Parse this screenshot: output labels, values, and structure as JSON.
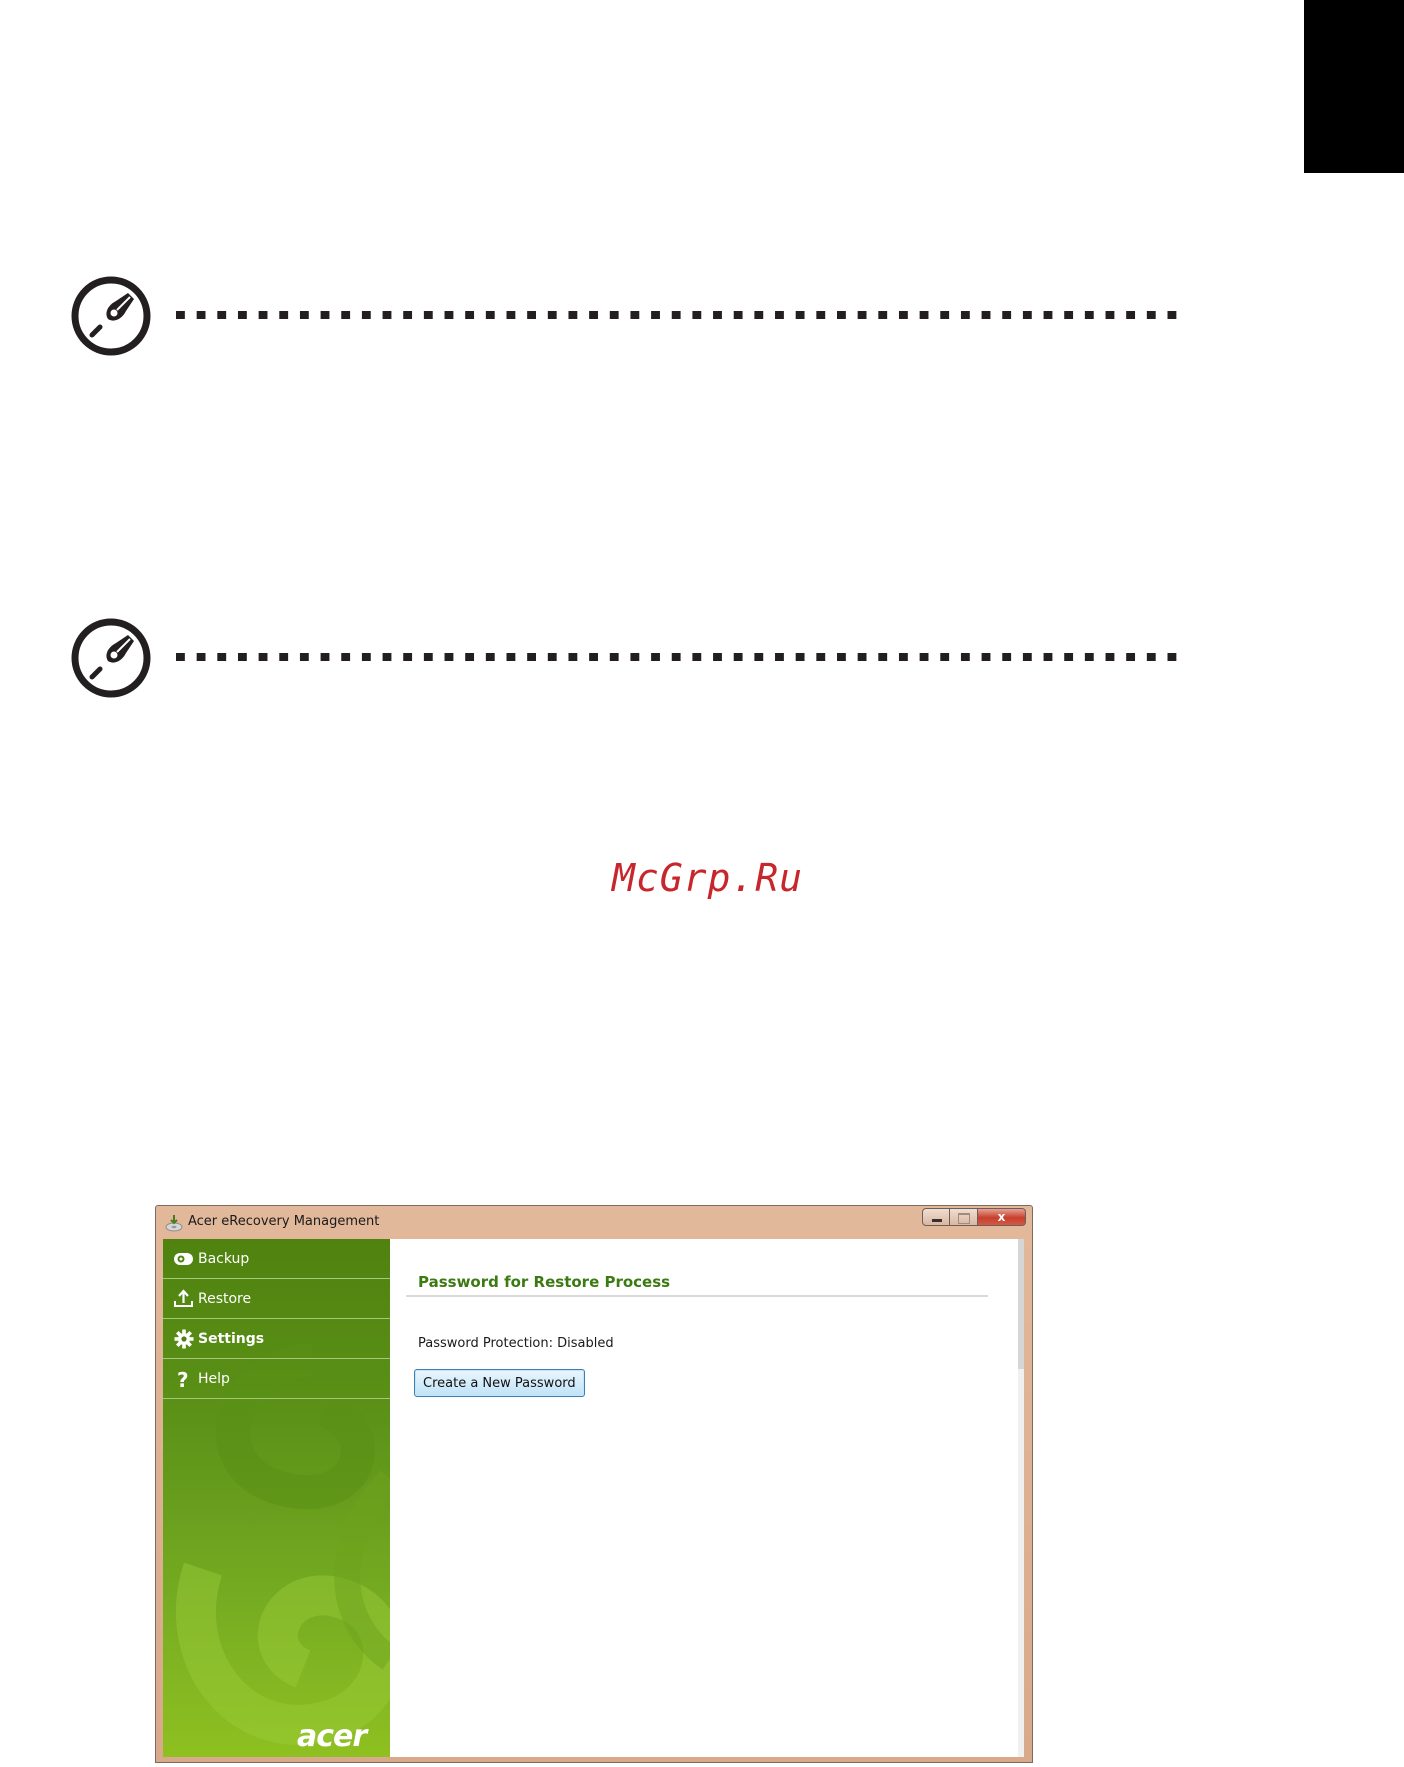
{
  "window": {
    "title": "Acer eRecovery Management",
    "close_glyph": "x"
  },
  "sidebar": {
    "items": [
      {
        "label": "Backup",
        "icon": "backup-icon"
      },
      {
        "label": "Restore",
        "icon": "restore-icon"
      },
      {
        "label": "Settings",
        "icon": "gear-icon",
        "active": true
      },
      {
        "label": "Help",
        "icon": "help-icon"
      }
    ],
    "logo": "acer"
  },
  "content": {
    "heading": "Password for Restore Process",
    "status": "Password Protection: Disabled",
    "create_button": "Create a New Password"
  },
  "watermark": "McGrp.Ru",
  "colors": {
    "accent_green": "#3c7a12",
    "watermark_red": "#c8262d"
  }
}
